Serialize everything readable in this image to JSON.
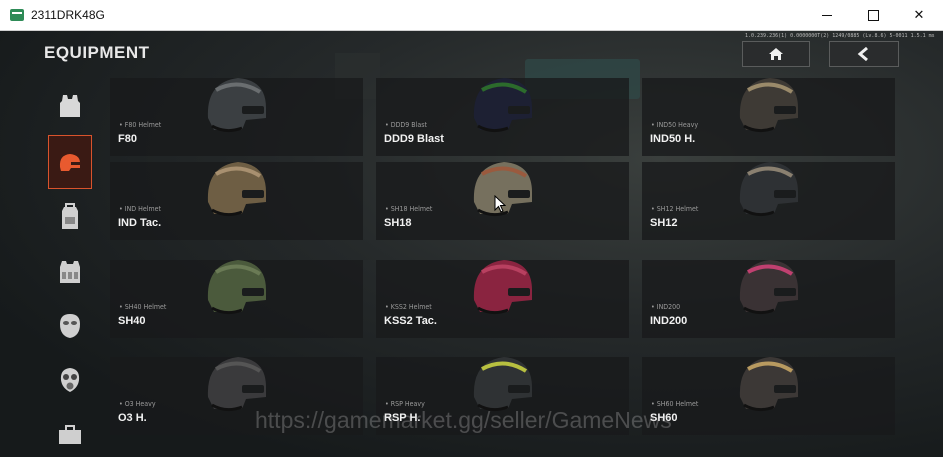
{
  "window": {
    "title": "2311DRK48G",
    "minimize_symbol": "",
    "maximize_symbol": "",
    "close_symbol": "✕"
  },
  "header": {
    "title": "EQUIPMENT",
    "info_text": "1.0.239.236(1) 0.0000000T(2) 1249/0885 (Lv.8.6) 5-0011 1.5.1 ms"
  },
  "nav": {
    "home_icon": "home-icon",
    "back_icon": "back-icon"
  },
  "sidebar": {
    "items": [
      {
        "icon": "vest-icon",
        "active": false
      },
      {
        "icon": "helmet-icon",
        "active": true
      },
      {
        "icon": "backpack-icon",
        "active": false
      },
      {
        "icon": "rig-icon",
        "active": false
      },
      {
        "icon": "mask-icon",
        "active": false
      },
      {
        "icon": "gasmask-icon",
        "active": false
      },
      {
        "icon": "case-icon",
        "active": false
      }
    ]
  },
  "cards": [
    {
      "category": "F80 Helmet",
      "name": "F80",
      "color": "#3b3f42",
      "accent": "#6a6e70"
    },
    {
      "category": "DDD9 Blast",
      "name": "DDD9 Blast",
      "color": "#1d2033",
      "accent": "#2c6b2c"
    },
    {
      "category": "IND50 Heavy",
      "name": "IND50 H.",
      "color": "#3e3a35",
      "accent": "#9a8a6a"
    },
    {
      "category": "IND Helmet",
      "name": "IND Tac.",
      "color": "#6e5e44",
      "accent": "#a89070"
    },
    {
      "category": "SH18 Helmet",
      "name": "SH18",
      "color": "#76705e",
      "accent": "#9a5a3e"
    },
    {
      "category": "SH12 Helmet",
      "name": "SH12",
      "color": "#2e3134",
      "accent": "#8a8070"
    },
    {
      "category": "SH40 Helmet",
      "name": "SH40",
      "color": "#4b5a3c",
      "accent": "#6a7a55"
    },
    {
      "category": "KSS2 Helmet",
      "name": "KSS2 Tac.",
      "color": "#8a2440",
      "accent": "#b84060"
    },
    {
      "category": "IND200",
      "name": "IND200",
      "color": "#3a3234",
      "accent": "#c04070"
    },
    {
      "category": "O3 Heavy",
      "name": "O3 H.",
      "color": "#3a3a3c",
      "accent": "#555"
    },
    {
      "category": "RSP Heavy",
      "name": "RSP H.",
      "color": "#2f3234",
      "accent": "#b8c040"
    },
    {
      "category": "SH60 Helmet",
      "name": "SH60",
      "color": "#3c3836",
      "accent": "#b89a60"
    }
  ],
  "watermark": "https://gamemarket.gg/seller/GameNews"
}
